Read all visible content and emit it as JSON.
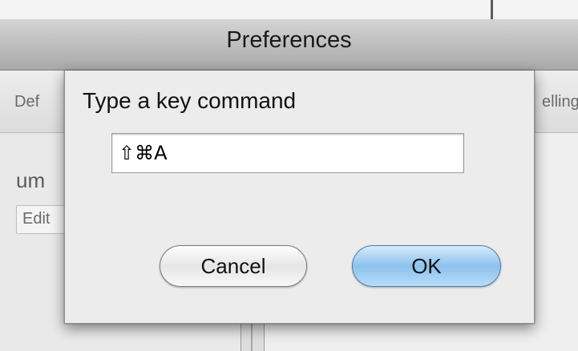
{
  "window": {
    "title": "Preferences"
  },
  "background": {
    "tab_left_partial": "Def",
    "tab_right_partial": "elling",
    "heading_partial": "um",
    "button_partial": "Edit"
  },
  "dialog": {
    "prompt": "Type a key command",
    "key_field_value": "⇧⌘A",
    "cancel_label": "Cancel",
    "ok_label": "OK"
  },
  "colors": {
    "ok_button": "#8cc2ee",
    "title_bar": "#bdbdbd"
  }
}
